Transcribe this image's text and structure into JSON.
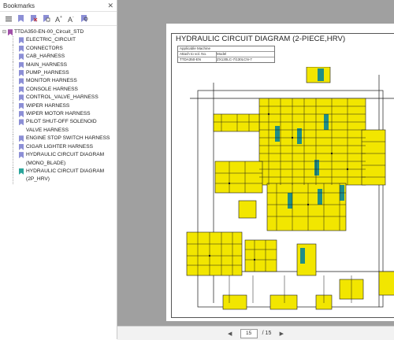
{
  "sidebar": {
    "title": "Bookmarks",
    "close": "✕",
    "root": "TTDA350-EN-00_Circuit_STD",
    "items": [
      {
        "label": "ELECTRIC_CIRCUIT",
        "color": "lav"
      },
      {
        "label": "CONNECTORS",
        "color": "lav"
      },
      {
        "label": "CAB_HARNESS",
        "color": "lav"
      },
      {
        "label": "MAIN_HARNESS",
        "color": "lav"
      },
      {
        "label": "PUMP_HARNESS",
        "color": "lav"
      },
      {
        "label": "MONITOR HARNESS",
        "color": "lav"
      },
      {
        "label": "CONSOLE HARNESS",
        "color": "lav"
      },
      {
        "label": "CONTROL_VALVE_HARNESS",
        "color": "lav"
      },
      {
        "label": "WIPER HARNESS",
        "color": "lav"
      },
      {
        "label": "WIPER MOTOR HARNESS",
        "color": "lav"
      },
      {
        "label": "PILOT SHUT-OFF SOLENOID VALVE HARNESS",
        "color": "lav"
      },
      {
        "label": "ENGINE STOP SWITCH HARNESS",
        "color": "lav"
      },
      {
        "label": "CIGAR LIGHTER HARNESS",
        "color": "lav"
      },
      {
        "label": "HYDRAULIC CIRCUIT DIAGRAM (MONO_BLADE)",
        "color": "lav"
      },
      {
        "label": "HYDRAULIC CIRCUIT DIAGRAM (2P_HRV)",
        "color": "teal"
      }
    ]
  },
  "document": {
    "title": "HYDRAULIC CIRCUIT DIAGRAM (2-PIECE,HRV)",
    "meta_header": "Applicable Machine",
    "meta_row1_a": "Attach to vol. No.",
    "meta_row1_b": "Model",
    "meta_row2_a": "TTDA350-EN",
    "meta_row2_b": "ZX130LC-7/130LCN-7"
  },
  "nav": {
    "page": "15",
    "total": "/ 15"
  },
  "colors": {
    "yellow": "#f2e600",
    "line": "#1a1a1a",
    "teal": "#1f8e87",
    "viewer_bg": "#a0a0a0"
  }
}
